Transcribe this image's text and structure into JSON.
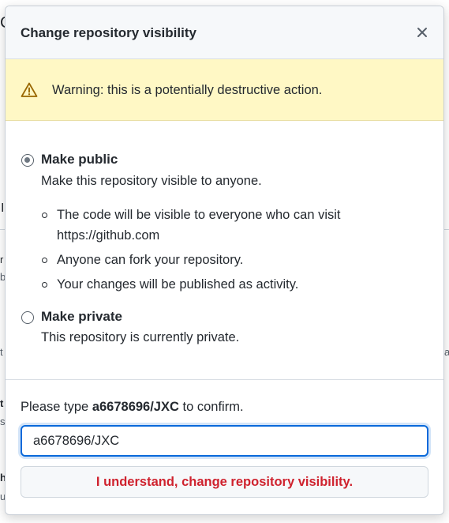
{
  "background": {
    "fragments": [
      "C",
      "I",
      "r",
      "b",
      "t",
      "a",
      "t",
      "s",
      "h",
      "u"
    ]
  },
  "dialog": {
    "title": "Change repository visibility",
    "close_icon": "close-icon"
  },
  "warning": {
    "icon": "alert-triangle-icon",
    "text": "Warning: this is a potentially destructive action."
  },
  "options": {
    "public": {
      "label": "Make public",
      "checked": true,
      "description": "Make this repository visible to anyone.",
      "bullets": [
        "The code will be visible to everyone who can visit https://github.com",
        "Anyone can fork your repository.",
        "Your changes will be published as activity."
      ]
    },
    "private": {
      "label": "Make private",
      "checked": false,
      "description": "This repository is currently private."
    }
  },
  "confirm": {
    "prefix": "Please type ",
    "repo": "a6678696/JXC",
    "suffix": " to confirm.",
    "input_value": "a6678696/JXC"
  },
  "danger_button": {
    "label": "I understand, change repository visibility."
  },
  "colors": {
    "accent": "#0969da",
    "danger": "#cf222e",
    "warning_bg": "#fff8c5",
    "warning_icon": "#9a6700",
    "header_bg": "#f6f8fa"
  }
}
